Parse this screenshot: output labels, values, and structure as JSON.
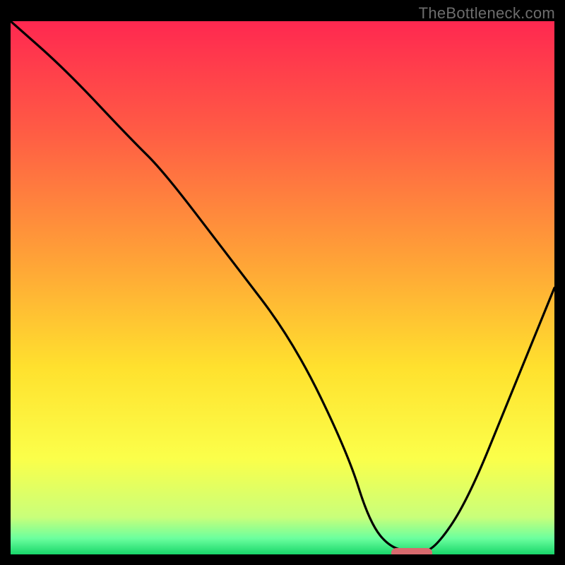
{
  "watermark": "TheBottleneck.com",
  "chart_data": {
    "type": "line",
    "title": "",
    "xlabel": "",
    "ylabel": "",
    "xlim": [
      0,
      100
    ],
    "ylim": [
      0,
      100
    ],
    "grid": false,
    "legend": false,
    "gradient_stops": [
      {
        "pos": 0,
        "color": "#ff2850"
      },
      {
        "pos": 20,
        "color": "#ff5a45"
      },
      {
        "pos": 45,
        "color": "#ffa337"
      },
      {
        "pos": 65,
        "color": "#ffe12e"
      },
      {
        "pos": 82,
        "color": "#fbff4a"
      },
      {
        "pos": 93,
        "color": "#c9ff7a"
      },
      {
        "pos": 97,
        "color": "#6bff9e"
      },
      {
        "pos": 100,
        "color": "#18d66a"
      }
    ],
    "series": [
      {
        "name": "bottleneck-curve",
        "x": [
          0,
          10,
          22,
          28,
          40,
          52,
          62,
          66,
          70,
          75,
          78,
          84,
          92,
          100
        ],
        "y": [
          100,
          91,
          78,
          72,
          56,
          40,
          19,
          6,
          1,
          0.5,
          1,
          10,
          30,
          50
        ]
      }
    ],
    "marker": {
      "x_start": 70,
      "x_end": 77.5,
      "y": 0
    }
  }
}
